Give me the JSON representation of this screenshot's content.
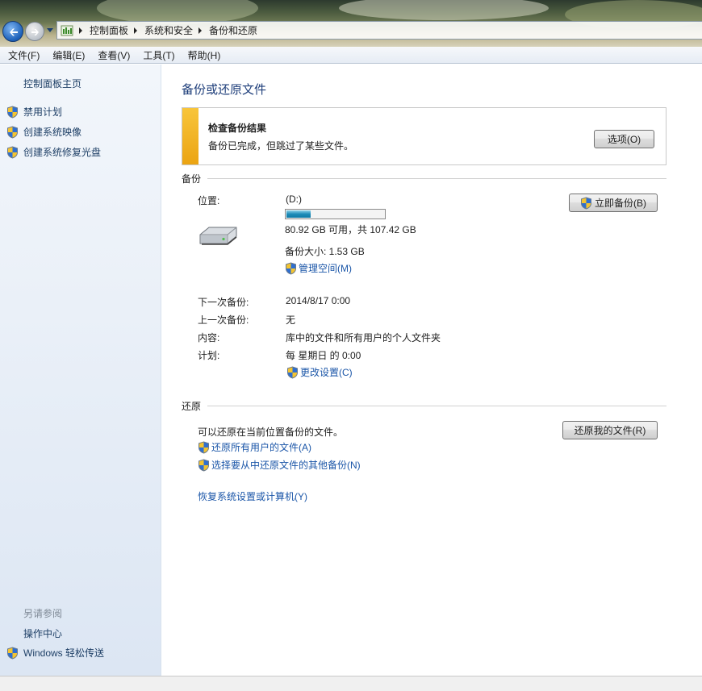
{
  "address_bar": {
    "breadcrumbs": [
      "控制面板",
      "系统和安全",
      "备份和还原"
    ]
  },
  "menu": [
    "文件(F)",
    "编辑(E)",
    "查看(V)",
    "工具(T)",
    "帮助(H)"
  ],
  "sidebar": {
    "home": "控制面板主页",
    "tasks": [
      {
        "label": "禁用计划",
        "icon": "uac-shield-icon"
      },
      {
        "label": "创建系统映像",
        "icon": "uac-shield-icon"
      },
      {
        "label": "创建系统修复光盘",
        "icon": "uac-shield-icon"
      }
    ],
    "see_also_title": "另请参阅",
    "see_also": [
      {
        "label": "操作中心"
      },
      {
        "label": "Windows 轻松传送",
        "icon": "uac-shield-icon"
      }
    ]
  },
  "main": {
    "title": "备份或还原文件",
    "alert": {
      "title": "检查备份结果",
      "message": "备份已完成，但跳过了某些文件。",
      "button": "选项(O)",
      "color": "#f0b020"
    },
    "backup": {
      "heading": "备份",
      "location_label": "位置:",
      "location_value": "(D:)",
      "usage_fraction": 0.25,
      "space_text": "80.92 GB 可用，共 107.42 GB",
      "backup_size": "备份大小: 1.53 GB",
      "manage_space": "管理空间(M)",
      "backup_now": "立即备份(B)",
      "rows": [
        {
          "label": "下一次备份:",
          "value": "2014/8/17 0:00"
        },
        {
          "label": "上一次备份:",
          "value": "无"
        },
        {
          "label": "内容:",
          "value": "库中的文件和所有用户的个人文件夹"
        },
        {
          "label": "计划:",
          "value": "每 星期日 的 0:00"
        }
      ],
      "change_settings": "更改设置(C)"
    },
    "restore": {
      "heading": "还原",
      "description": "可以还原在当前位置备份的文件。",
      "restore_my_files": "还原我的文件(R)",
      "restore_all_users": "还原所有用户的文件(A)",
      "select_other_backup": "选择要从中还原文件的其他备份(N)",
      "recover_system": "恢复系统设置或计算机(Y)"
    }
  },
  "colors": {
    "link": "#1b56a8",
    "title": "#1e3e7a",
    "progress": "#1d8cb8"
  }
}
